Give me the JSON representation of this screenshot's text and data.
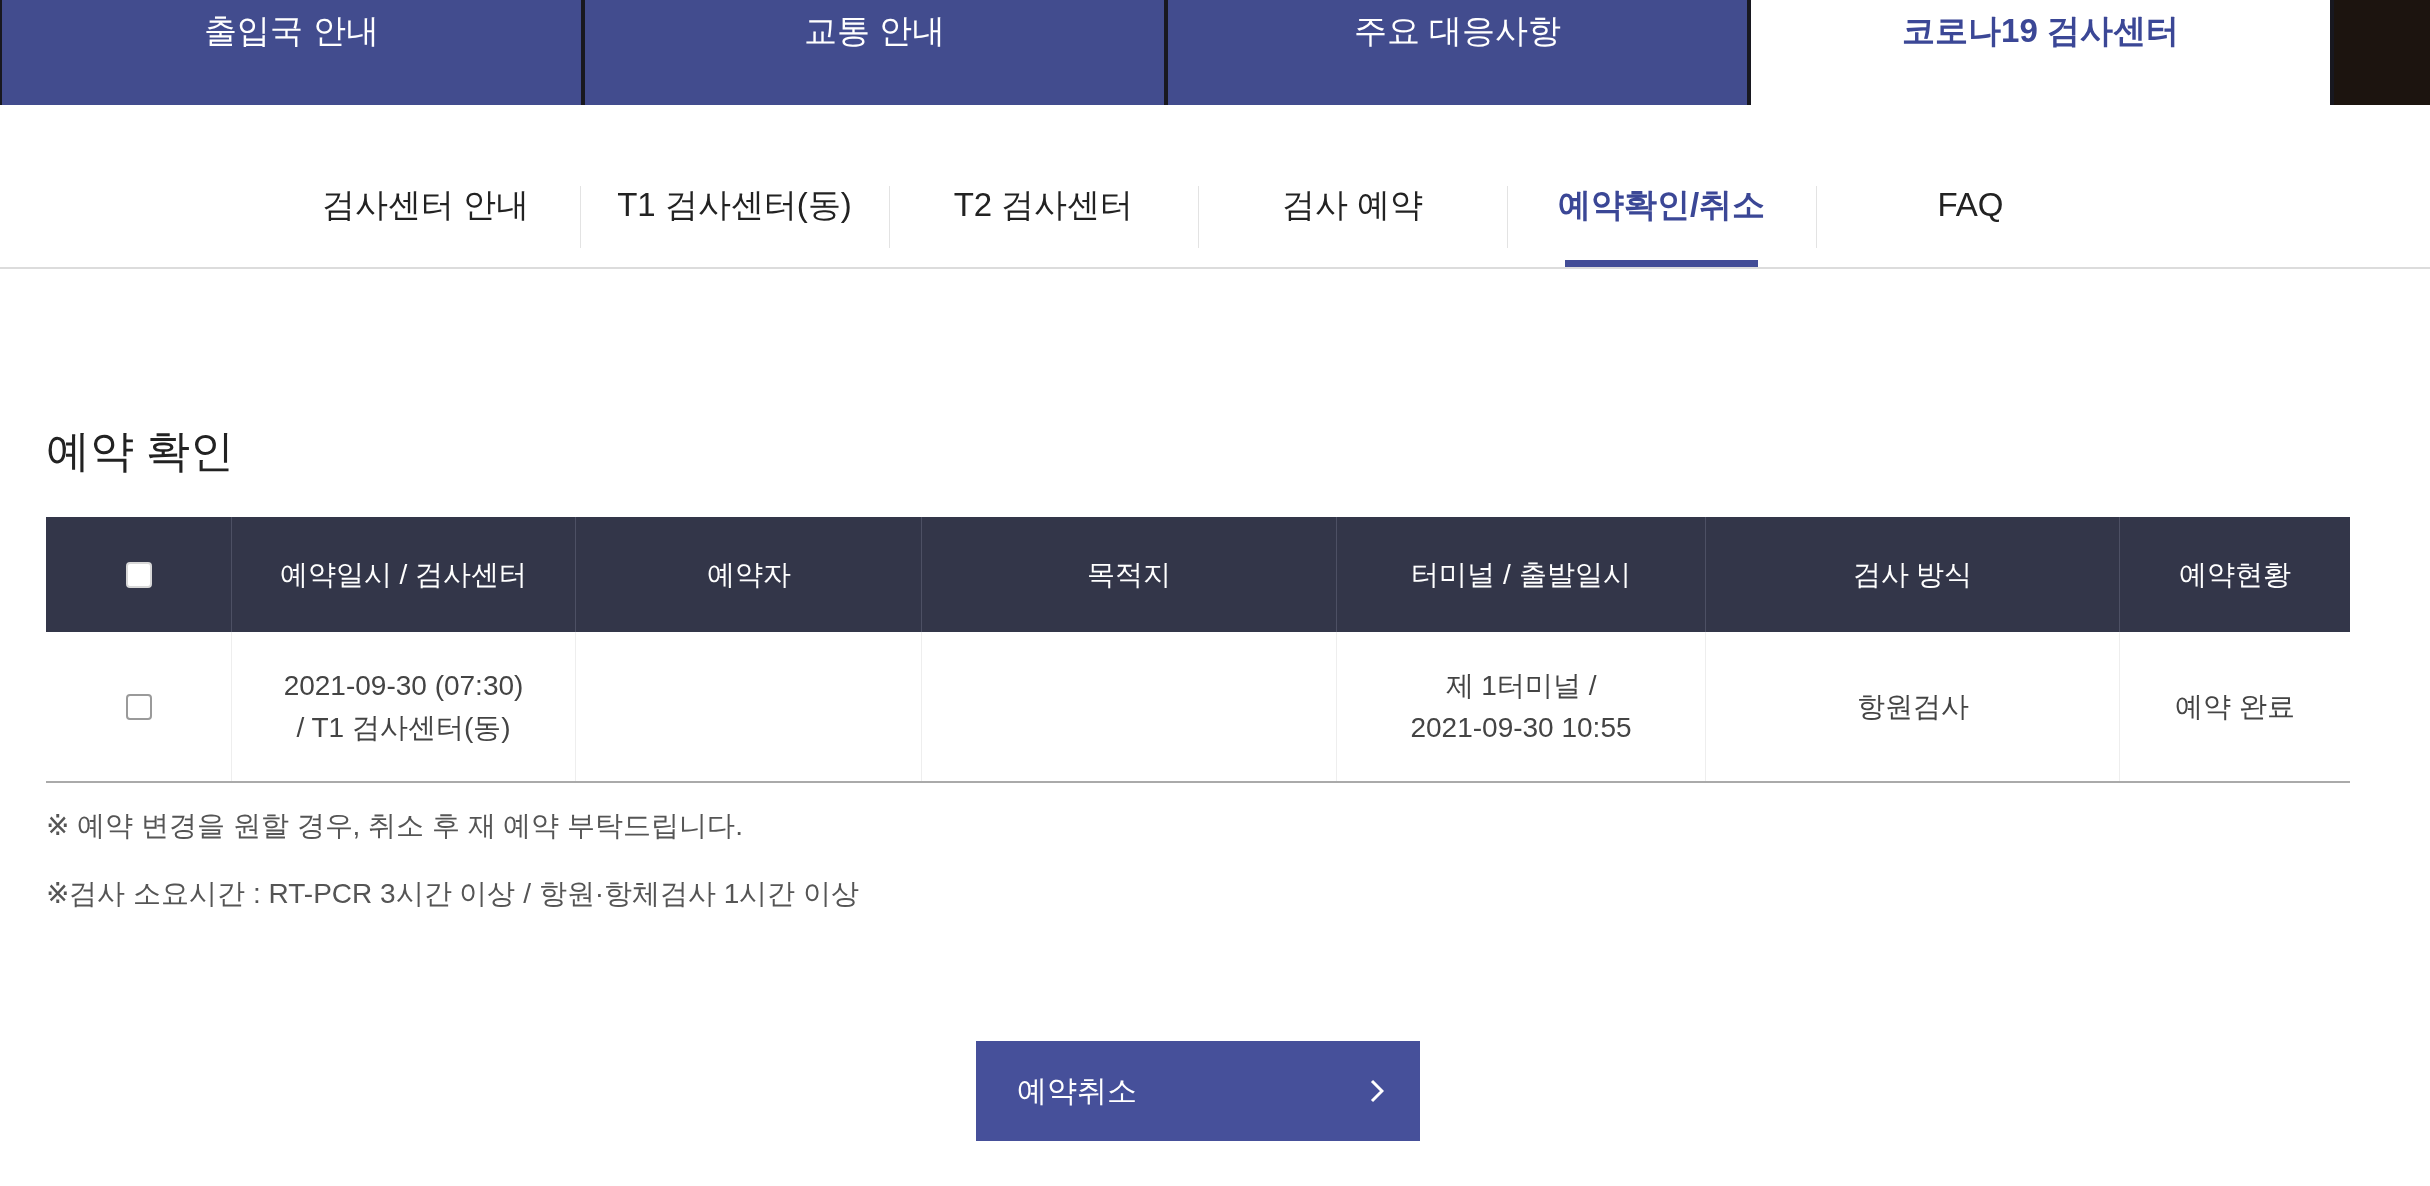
{
  "top_tabs": [
    {
      "label": "출입국 안내",
      "selected": false
    },
    {
      "label": "교통 안내",
      "selected": false
    },
    {
      "label": "주요 대응사항",
      "selected": false
    },
    {
      "label": "코로나19 검사센터",
      "selected": true
    }
  ],
  "sub_nav": [
    {
      "label": "검사센터 안내",
      "selected": false
    },
    {
      "label": "T1 검사센터(동)",
      "selected": false
    },
    {
      "label": "T2 검사센터",
      "selected": false
    },
    {
      "label": "검사 예약",
      "selected": false
    },
    {
      "label": "예약확인/취소",
      "selected": true
    },
    {
      "label": "FAQ",
      "selected": false
    }
  ],
  "heading": "예약 확인",
  "table": {
    "columns": [
      {
        "kind": "checkbox",
        "checked": false
      },
      {
        "kind": "label",
        "label": "예약일시 / 검사센터"
      },
      {
        "kind": "label",
        "label": "예약자"
      },
      {
        "kind": "label",
        "label": "목적지"
      },
      {
        "kind": "label",
        "label": "터미널 / 출발일시"
      },
      {
        "kind": "label",
        "label": "검사 방식"
      },
      {
        "kind": "label",
        "label": "예약현황"
      }
    ],
    "rows": [
      {
        "cells": [
          {
            "kind": "checkbox",
            "checked": false
          },
          {
            "kind": "text",
            "lines": [
              "2021-09-30 (07:30)",
              "/ T1 검사센터(동)"
            ]
          },
          {
            "kind": "blank"
          },
          {
            "kind": "blank"
          },
          {
            "kind": "text",
            "lines": [
              "제 1터미널 /",
              "2021-09-30 10:55"
            ]
          },
          {
            "kind": "text",
            "lines": [
              "항원검사"
            ]
          },
          {
            "kind": "text",
            "lines": [
              "예약 완료"
            ]
          }
        ]
      }
    ]
  },
  "notes": [
    "※ 예약 변경을 원할 경우, 취소 후 재 예약 부탁드립니다.",
    "※검사 소요시간 : RT-PCR 3시간 이상 / 항원·항체검사 1시간 이상"
  ],
  "button": {
    "label": "예약취소"
  }
}
